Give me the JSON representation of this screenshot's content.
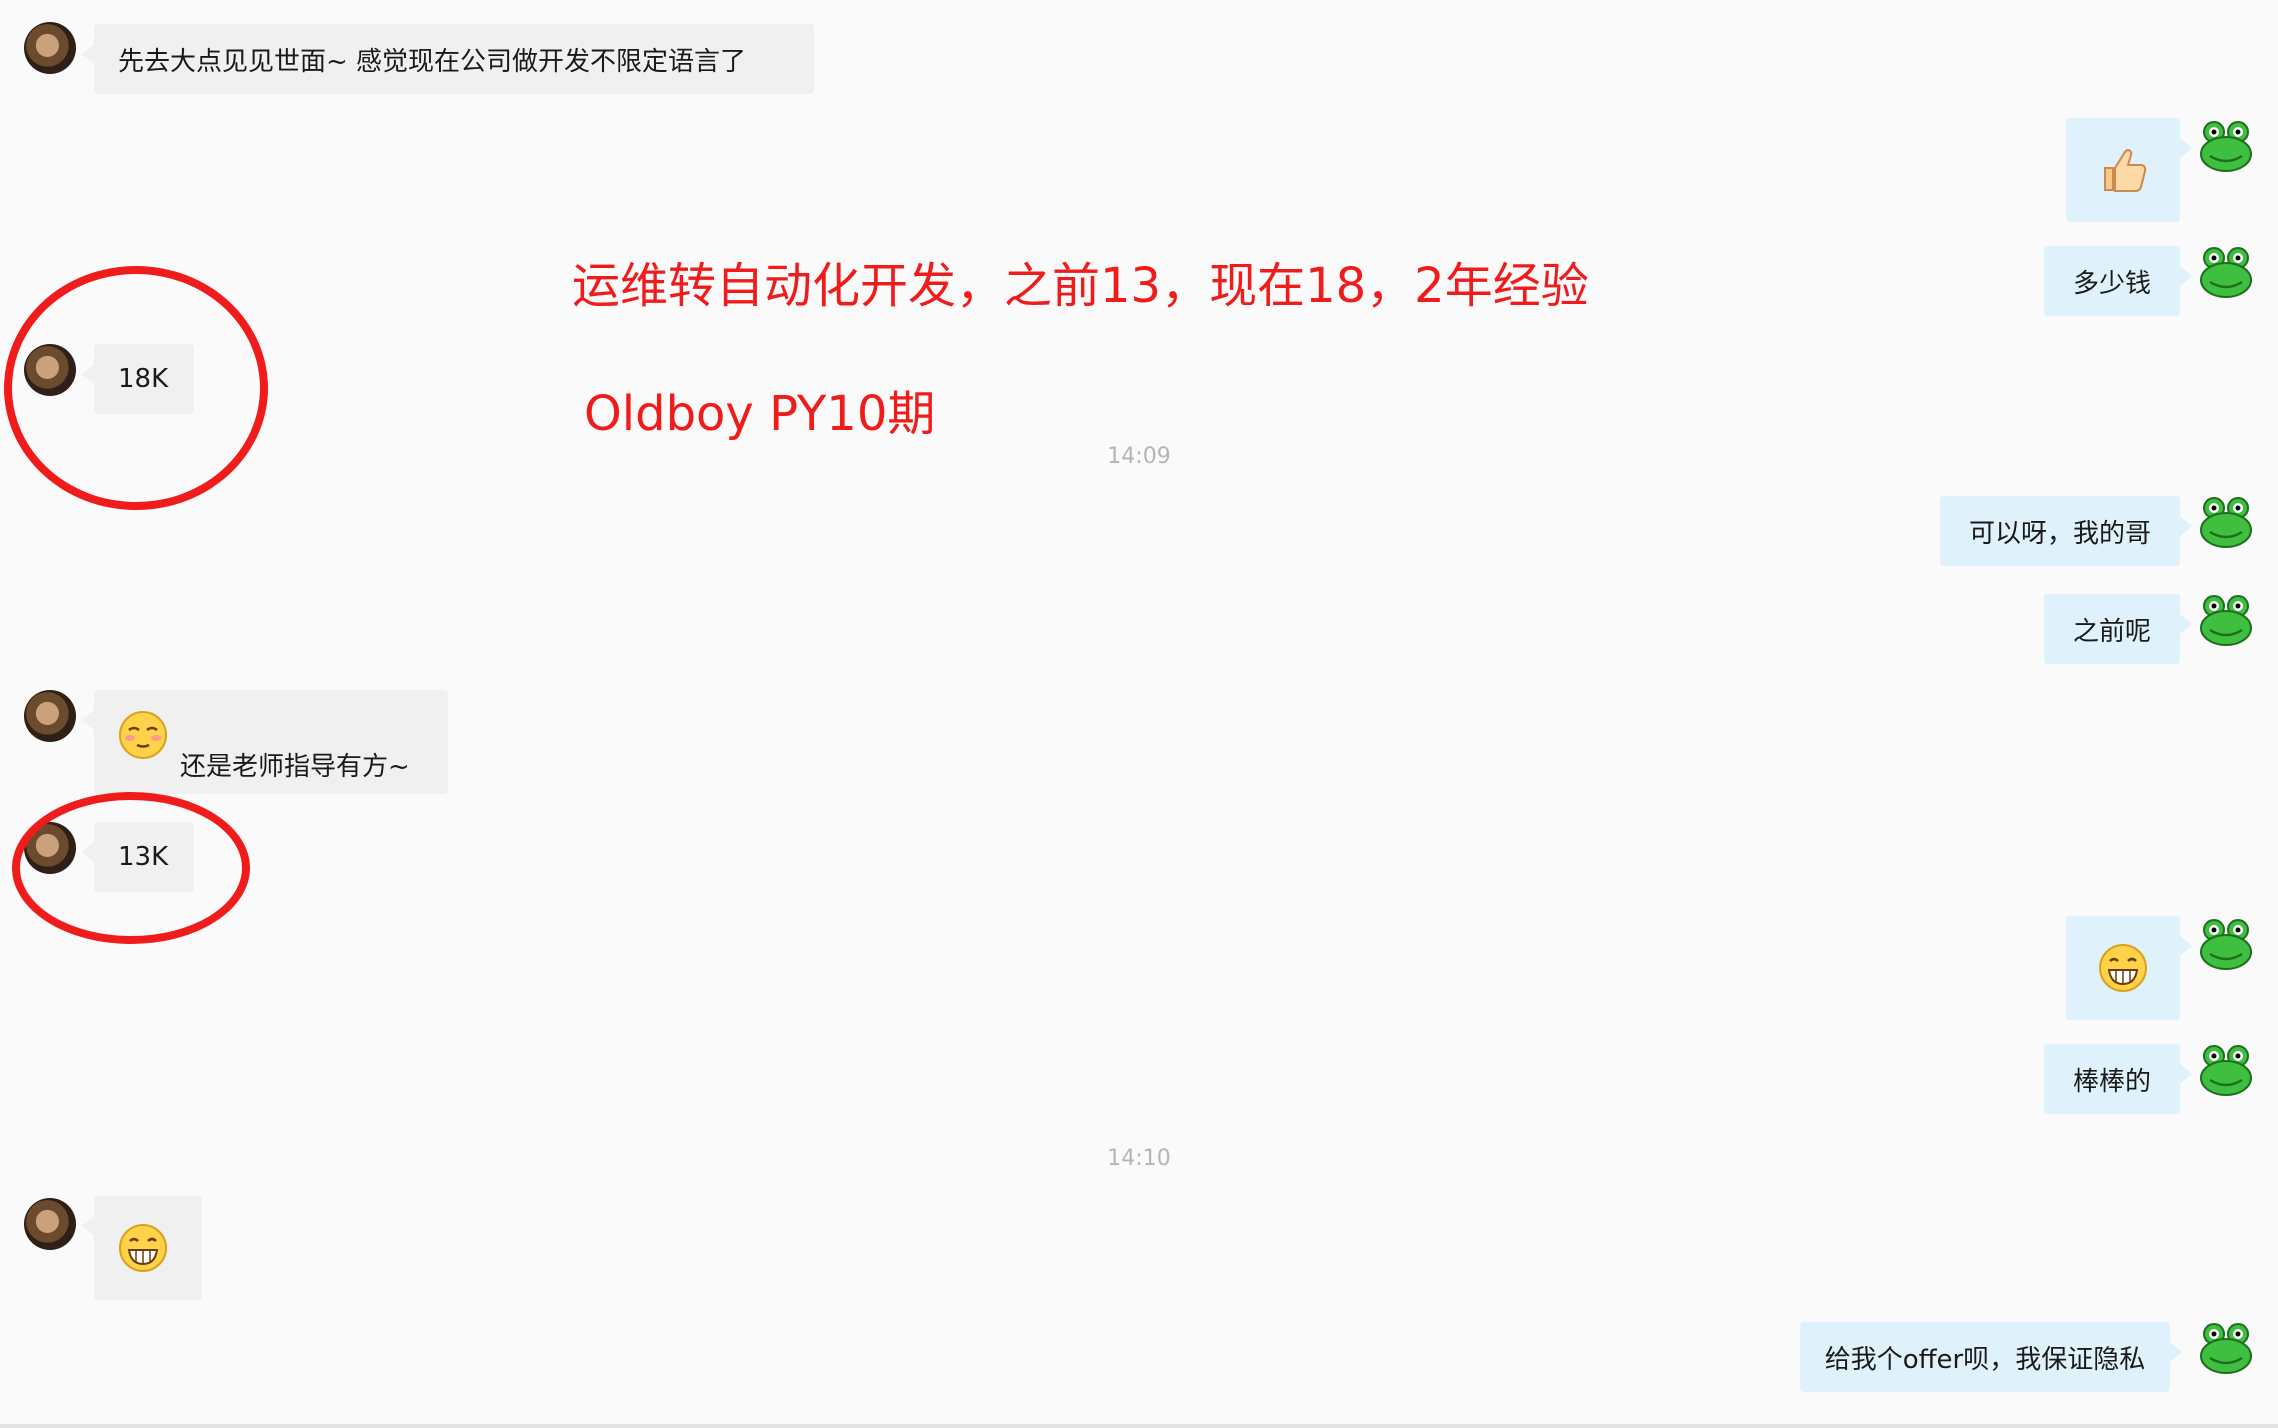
{
  "messages": {
    "m1": "先去大点见见世面~ 感觉现在公司做开发不限定语言了",
    "m3": "多少钱",
    "m4": "18K",
    "m5": "可以呀，我的哥",
    "m6": "之前呢",
    "m7": "还是老师指导有方~",
    "m8": "13K",
    "m10": "棒棒的",
    "m12": "给我个offer呗，我保证隐私"
  },
  "timestamps": {
    "t1": "14:09",
    "t2": "14:10"
  },
  "annotations": {
    "line1": "运维转自动化开发，之前13，现在18，2年经验",
    "line2": "Oldboy PY10期"
  },
  "icons": {
    "sender_avatar": "user-photo-avatar",
    "self_avatar": "frog-avatar",
    "thumbs_up": "thumbs-up-emoji",
    "grin": "grinning-emoji",
    "shy": "shy-emoji"
  },
  "colors": {
    "annotation": "#f01c1c",
    "incoming_bubble": "#f0f0f0",
    "outgoing_bubble": "#dff1fa"
  }
}
